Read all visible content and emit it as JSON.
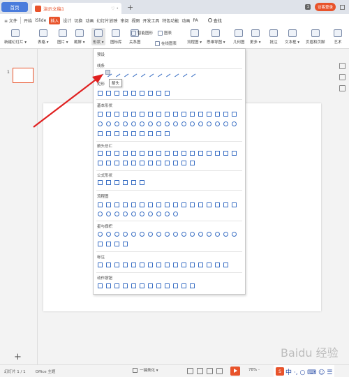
{
  "titlebar": {
    "home_tab": "首页",
    "doc_tab": "演示文稿1",
    "tab_controls": "♡ •",
    "new_tab": "+",
    "badge": "1",
    "login": "访客登录"
  },
  "menubar": {
    "file": "≡ 文件",
    "items": [
      "开始",
      "iSlide",
      "插入",
      "设计",
      "切换",
      "动画",
      "幻灯片放映",
      "审阅",
      "视图",
      "开发工具",
      "特色功能",
      "动画",
      "PA"
    ],
    "active_item": "插入",
    "search": "查找"
  },
  "ribbon": {
    "new_slide": "新建幻灯片 ▾",
    "table": "表格 ▾",
    "picture": "图片 ▾",
    "screenshot": "截屏 ▾",
    "shape": "形状 ▾",
    "icon_lib": "图标库",
    "relation": "关系图",
    "smart_graphic": "智能图形",
    "chart": "图表",
    "online_chart": "在线图表",
    "flowchart": "流程图 ▾",
    "mindmap": "思维导图 ▾",
    "geometry": "几何图",
    "more": "更多 ▾",
    "comment": "批注",
    "textbox": "文本框 ▾",
    "header_footer": "页眉和页脚",
    "art": "艺术"
  },
  "left_panel": {
    "slide_number": "1",
    "add_slide": "+"
  },
  "dropdown": {
    "preset": "预设",
    "sections": [
      "线条",
      "矩形",
      "基本形状",
      "箭头总汇",
      "公式形状",
      "流程图",
      "星与旗帜",
      "标注",
      "动作按钮"
    ],
    "tooltip": "箭头"
  },
  "statusbar": {
    "slide_info": "幻灯片 1 / 1",
    "theme": "Office 主题",
    "beautify": "一键美化 ▾",
    "zoom": "78% -"
  },
  "watermark": {
    "logo": "S",
    "text": "中 ·, ○ ⌨ ☺ ☰",
    "baidu": "Baidu 经验"
  },
  "colors": {
    "accent": "#e8532b",
    "shape_stroke": "#3a6fc4"
  }
}
